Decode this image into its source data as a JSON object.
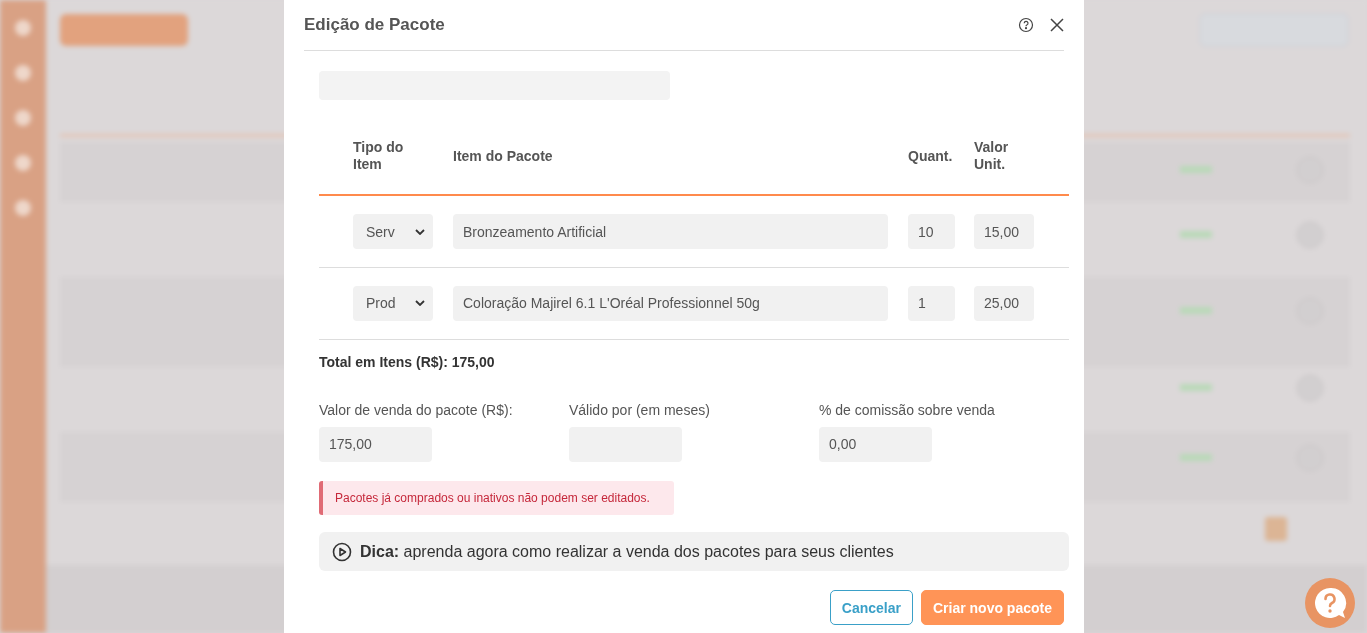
{
  "dialog": {
    "title": "Edição de Pacote"
  },
  "items_table": {
    "columns": [
      "Tipo do Item",
      "Item do Pacote",
      "Quant.",
      "Valor Unit."
    ],
    "rows": [
      {
        "type": "Serv",
        "item": "Bronzeamento Artificial",
        "quantity": "10",
        "unit_value": "15,00"
      },
      {
        "type": "Prod",
        "item": "Coloração Majirel 6.1 L'Oréal Professionnel 50g",
        "quantity": "1",
        "unit_value": "25,00"
      }
    ]
  },
  "total": "Total em Itens (R$): 175,00",
  "fields": [
    {
      "label": "Valor de venda do pacote (R$):",
      "value": "175,00"
    },
    {
      "label": "Válido por (em meses)"
    },
    {
      "label": "% de comissão sobre venda",
      "value": "0,00"
    }
  ],
  "alert": "Pacotes já comprados ou inativos não podem ser editados.",
  "tip": "**Dica:** aprenda agora como realizar a venda dos pacotes para seus clientes",
  "buttons": [
    {
      "kind": "secondary",
      "label": "Cancelar"
    },
    {
      "kind": "primary",
      "label": "Criar novo pacote"
    }
  ]
}
